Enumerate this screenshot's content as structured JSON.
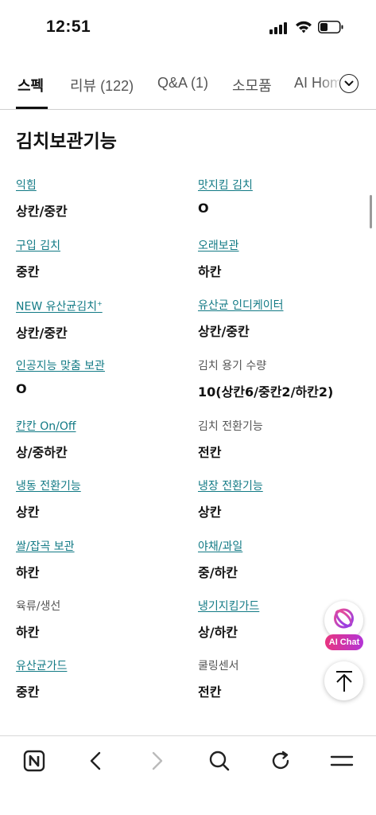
{
  "status_bar": {
    "time": "12:51"
  },
  "tabs": [
    {
      "label": "스펙",
      "active": true
    },
    {
      "label": "리뷰 (122)",
      "active": false
    },
    {
      "label": "Q&A (1)",
      "active": false
    },
    {
      "label": "소모품",
      "active": false
    },
    {
      "label": "AI Home",
      "active": false
    }
  ],
  "section": {
    "title": "김치보관기능",
    "items": [
      {
        "label": "익힘",
        "value": "상칸/중칸",
        "link": true
      },
      {
        "label": "맛지킴 김치",
        "value": "O",
        "link": true
      },
      {
        "label": "구입 김치",
        "value": "중칸",
        "link": true
      },
      {
        "label": "오래보관",
        "value": "하칸",
        "link": true
      },
      {
        "label": "NEW 유산균김치",
        "label_mark": "+",
        "value": "상칸/중칸",
        "link": true
      },
      {
        "label": "유산균 인디케이터",
        "value": "상칸/중칸",
        "link": true
      },
      {
        "label": "인공지능 맞춤 보관",
        "value": "O",
        "link": true
      },
      {
        "label": "김치 용기 수량",
        "value": "10(상칸6/중칸2/하칸2)",
        "link": false
      },
      {
        "label": "칸칸 On/Off",
        "value": "상/중하칸",
        "link": true
      },
      {
        "label": "김치 전환기능",
        "value": "전칸",
        "link": false
      },
      {
        "label": "냉동 전환기능",
        "value": "상칸",
        "link": true
      },
      {
        "label": "냉장 전환기능",
        "value": "상칸",
        "link": true
      },
      {
        "label": "쌀/잡곡 보관",
        "value": "하칸",
        "link": true
      },
      {
        "label": "야채/과일",
        "value": "중/하칸",
        "link": true
      },
      {
        "label": "육류/생선",
        "value": "하칸",
        "link": false
      },
      {
        "label": "냉기지킴가드",
        "value": "상/하칸",
        "link": true
      },
      {
        "label": "유산균가드",
        "value": "중칸",
        "link": true
      },
      {
        "label": "쿨링센서",
        "value": "전칸",
        "link": false
      }
    ]
  },
  "floating": {
    "ai_chat_label": "AI Chat"
  },
  "icons": {
    "tabs_more": "chevron-down-icon",
    "ai": "ai-chat-icon",
    "top": "arrow-up-icon",
    "nav": [
      "naver-home-icon",
      "back-icon",
      "forward-icon",
      "search-icon",
      "refresh-icon",
      "menu-icon"
    ]
  },
  "colors": {
    "link": "#127a85",
    "ai_badge": "#e8347f"
  }
}
